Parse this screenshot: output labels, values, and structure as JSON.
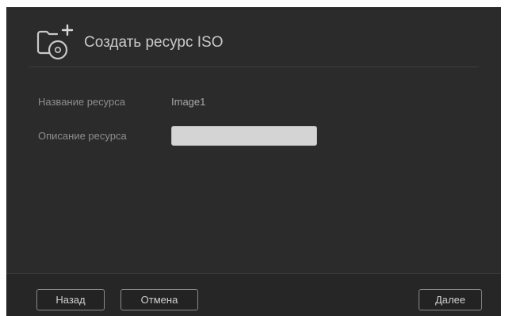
{
  "dialog": {
    "title": "Создать ресурс ISO",
    "icon": "folder-add-disc-icon"
  },
  "form": {
    "name_label": "Название ресурса",
    "name_value": "Image1",
    "description_label": "Описание ресурса",
    "description_value": "",
    "description_placeholder": ""
  },
  "footer": {
    "back_label": "Назад",
    "cancel_label": "Отмена",
    "next_label": "Далее"
  },
  "colors": {
    "dialog_background": "#2b2b2b",
    "input_background": "#d4d4d4",
    "button_border": "#8a8a8a"
  }
}
